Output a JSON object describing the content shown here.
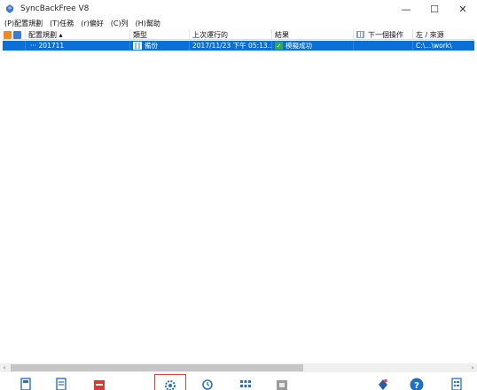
{
  "window": {
    "title": "SyncBackFree V8",
    "controls": {
      "minimize": "—",
      "maximize": "☐",
      "close": "✕"
    }
  },
  "menu": [
    "(P)配置規劃",
    "(T)任務",
    "(r)偏好",
    "(C)列",
    "(H)幫助"
  ],
  "columns": {
    "profile": "配置規劃 ▴",
    "type": "類型",
    "last_run": "上次運行的",
    "result": "結果",
    "next_run": "下一個操作",
    "source": "左 / 來源"
  },
  "rows": [
    {
      "profile": "··· 201711",
      "type": "備份",
      "last_run": "2017/11/23 下午 05:13...",
      "result": "模擬成功",
      "next_run": "",
      "source": "C:\\...\\work\\"
    }
  ],
  "scrollbar": {
    "left_arrow": "‹",
    "right_arrow": "›"
  },
  "toolbar": [
    {
      "icon": "new-profile-icon"
    },
    {
      "icon": "modify-profile-icon"
    },
    {
      "icon": "delete-profile-icon"
    },
    {
      "icon": "settings-gear-icon",
      "selected": true
    },
    {
      "icon": "history-icon"
    },
    {
      "icon": "grid-view-icon"
    },
    {
      "icon": "stop-icon"
    },
    {
      "icon": "diamond-icon"
    },
    {
      "icon": "help-icon"
    },
    {
      "icon": "log-icon"
    }
  ],
  "colors": {
    "selection": "#0a6fd6",
    "success": "#2fa84f",
    "toolbar_highlight": "#e0433d",
    "help_blue": "#1f6fc9"
  }
}
